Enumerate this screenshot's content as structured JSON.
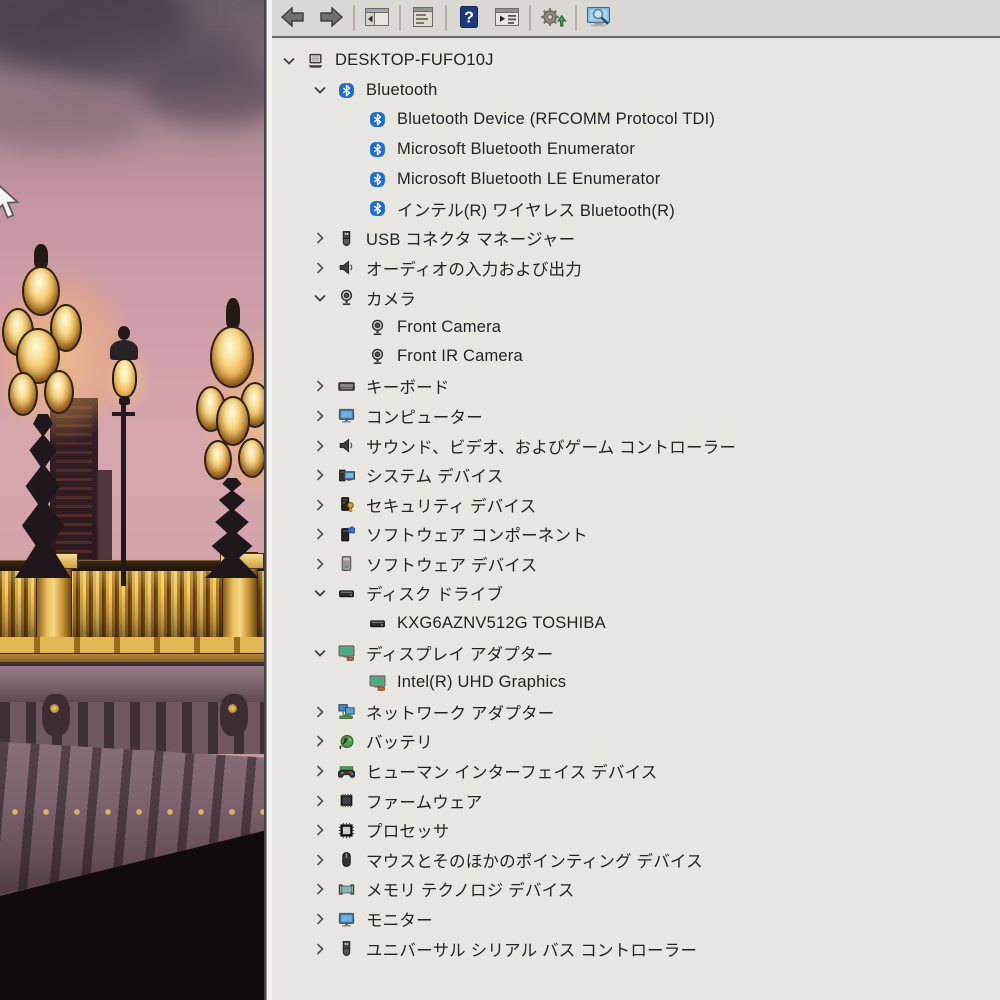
{
  "desktop": {
    "wallpaper_description": "Paris bridge lampposts at dusk",
    "cursor_visible": true
  },
  "toolbar": {
    "items": [
      {
        "type": "button",
        "name": "back",
        "icon": "toolbar-back"
      },
      {
        "type": "button",
        "name": "forward",
        "icon": "toolbar-forward"
      },
      {
        "type": "separator"
      },
      {
        "type": "button",
        "name": "console-tree",
        "icon": "toolbar-console-tree"
      },
      {
        "type": "separator"
      },
      {
        "type": "button",
        "name": "properties",
        "icon": "toolbar-properties"
      },
      {
        "type": "separator"
      },
      {
        "type": "button",
        "name": "help",
        "icon": "toolbar-help"
      },
      {
        "type": "button",
        "name": "action-pane",
        "icon": "toolbar-action-pane"
      },
      {
        "type": "separator"
      },
      {
        "type": "button",
        "name": "update-driver",
        "icon": "toolbar-update-driver"
      },
      {
        "type": "separator"
      },
      {
        "type": "button",
        "name": "scan-hardware",
        "icon": "toolbar-scan-computer"
      }
    ],
    "help_glyph": "?"
  },
  "tree": {
    "items": [
      {
        "label": "DESKTOP-FUFO10J",
        "icon": "computer",
        "level": 0,
        "state": "expanded"
      },
      {
        "label": "Bluetooth",
        "icon": "bluetooth",
        "level": 1,
        "state": "expanded"
      },
      {
        "label": "Bluetooth Device (RFCOMM Protocol TDI)",
        "icon": "bluetooth",
        "level": 2,
        "state": "none"
      },
      {
        "label": "Microsoft Bluetooth Enumerator",
        "icon": "bluetooth",
        "level": 2,
        "state": "none"
      },
      {
        "label": "Microsoft Bluetooth LE Enumerator",
        "icon": "bluetooth",
        "level": 2,
        "state": "none"
      },
      {
        "label": "インテル(R) ワイヤレス Bluetooth(R)",
        "icon": "bluetooth",
        "level": 2,
        "state": "none"
      },
      {
        "label": "USB コネクタ マネージャー",
        "icon": "usb",
        "level": 1,
        "state": "collapsed"
      },
      {
        "label": "オーディオの入力および出力",
        "icon": "speaker",
        "level": 1,
        "state": "collapsed"
      },
      {
        "label": "カメラ",
        "icon": "camera",
        "level": 1,
        "state": "expanded"
      },
      {
        "label": "Front Camera",
        "icon": "camera",
        "level": 2,
        "state": "none"
      },
      {
        "label": "Front IR Camera",
        "icon": "camera",
        "level": 2,
        "state": "none"
      },
      {
        "label": "キーボード",
        "icon": "keyboard",
        "level": 1,
        "state": "collapsed"
      },
      {
        "label": "コンピューター",
        "icon": "monitor-blue",
        "level": 1,
        "state": "collapsed"
      },
      {
        "label": "サウンド、ビデオ、およびゲーム コントローラー",
        "icon": "speaker",
        "level": 1,
        "state": "collapsed"
      },
      {
        "label": "システム デバイス",
        "icon": "system-devices",
        "level": 1,
        "state": "collapsed"
      },
      {
        "label": "セキュリティ デバイス",
        "icon": "security-device",
        "level": 1,
        "state": "collapsed"
      },
      {
        "label": "ソフトウェア コンポーネント",
        "icon": "software-component",
        "level": 1,
        "state": "collapsed"
      },
      {
        "label": "ソフトウェア デバイス",
        "icon": "software-device",
        "level": 1,
        "state": "collapsed"
      },
      {
        "label": "ディスク ドライブ",
        "icon": "disk-drive",
        "level": 1,
        "state": "expanded"
      },
      {
        "label": "KXG6AZNV512G TOSHIBA",
        "icon": "disk-drive",
        "level": 2,
        "state": "none"
      },
      {
        "label": "ディスプレイ アダプター",
        "icon": "display-adapter",
        "level": 1,
        "state": "expanded"
      },
      {
        "label": "Intel(R) UHD Graphics",
        "icon": "display-adapter",
        "level": 2,
        "state": "none"
      },
      {
        "label": "ネットワーク アダプター",
        "icon": "network-adapter",
        "level": 1,
        "state": "collapsed"
      },
      {
        "label": "バッテリ",
        "icon": "battery",
        "level": 1,
        "state": "collapsed"
      },
      {
        "label": "ヒューマン インターフェイス デバイス",
        "icon": "hid",
        "level": 1,
        "state": "collapsed"
      },
      {
        "label": "ファームウェア",
        "icon": "firmware",
        "level": 1,
        "state": "collapsed"
      },
      {
        "label": "プロセッサ",
        "icon": "processor",
        "level": 1,
        "state": "collapsed"
      },
      {
        "label": "マウスとそのほかのポインティング デバイス",
        "icon": "mouse",
        "level": 1,
        "state": "collapsed"
      },
      {
        "label": "メモリ テクノロジ デバイス",
        "icon": "memory",
        "level": 1,
        "state": "collapsed"
      },
      {
        "label": "モニター",
        "icon": "monitor-blue",
        "level": 1,
        "state": "collapsed"
      },
      {
        "label": "ユニバーサル シリアル バス コントローラー",
        "icon": "usb",
        "level": 1,
        "state": "collapsed"
      }
    ]
  },
  "colors": {
    "window_bg": "#e8e6e1",
    "toolbar_bg": "#dad8d2",
    "text": "#232323",
    "bluetooth_blue": "#1e6ed2",
    "help_blue": "#1d3c7d",
    "screen_blue": "#3f86c8",
    "battery_green": "#4da04a",
    "adapter_teal": "#3fae80",
    "lamp_gold": "#e9b254",
    "sky_pink": "#d2a3ab",
    "bridge_mauve": "#7b626c",
    "shadow_black": "#110b0f"
  }
}
